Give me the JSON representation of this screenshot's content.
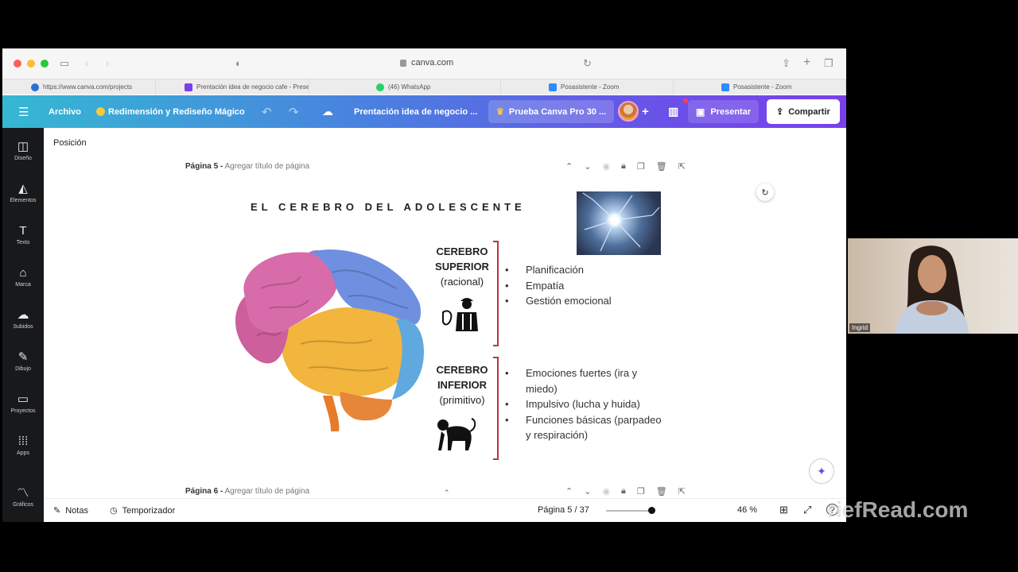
{
  "browser": {
    "address": "canva.com",
    "tabs": [
      {
        "label": "https://www.canva.com/projects",
        "icon": "canva-favicon",
        "color": "#2b6fd6"
      },
      {
        "label": "Prentación idea de negocio cafe - Presen...",
        "icon": "canva-favicon",
        "color": "#7a3fea"
      },
      {
        "label": "(46) WhatsApp",
        "icon": "whatsapp-favicon",
        "color": "#25d366"
      },
      {
        "label": "Posasistente - Zoom",
        "icon": "zoom-favicon",
        "color": "#2d8cff"
      },
      {
        "label": "Posasistente - Zoom",
        "icon": "zoom-favicon",
        "color": "#2d8cff"
      }
    ]
  },
  "header": {
    "archivo": "Archivo",
    "magic": "Redimensión y Rediseño Mágico",
    "doc_title": "Prentación idea de negocio ...",
    "pro": "Prueba Canva Pro 30 ...",
    "presentar": "Presentar",
    "compartir": "Compartir",
    "accent": "#7a3fea"
  },
  "rail": [
    {
      "label": "Diseño",
      "icon": "layout-icon"
    },
    {
      "label": "Elementos",
      "icon": "shapes-icon"
    },
    {
      "label": "Texto",
      "icon": "text-icon"
    },
    {
      "label": "Marca",
      "icon": "brand-icon"
    },
    {
      "label": "Subidos",
      "icon": "upload-icon"
    },
    {
      "label": "Dibujo",
      "icon": "draw-icon"
    },
    {
      "label": "Proyectos",
      "icon": "folder-icon"
    },
    {
      "label": "Apps",
      "icon": "apps-icon"
    },
    {
      "label": "Gráficos",
      "icon": "charts-icon"
    }
  ],
  "canvas": {
    "posicion": "Posición",
    "page5_num": "Página 5 -",
    "page5_sub": "Agregar título de página",
    "page6_num": "Página 6 -",
    "page6_sub": "Agregar título de página"
  },
  "slide": {
    "title": "EL CEREBRO DEL ADOLESCENTE",
    "superior": {
      "l1": "CEREBRO",
      "l2": "SUPERIOR",
      "l3": "(racional)"
    },
    "inferior": {
      "l1": "CEREBRO",
      "l2": "INFERIOR",
      "l3": "(primitivo)"
    },
    "superior_items": [
      "Planificación",
      "Empatía",
      "Gestión emocional"
    ],
    "inferior_items": [
      "Emociones fuertes (ira y miedo)",
      "Impulsivo (lucha y huida)",
      "Funciones básicas (parpadeo y respiración)"
    ]
  },
  "footer": {
    "notas": "Notas",
    "temporizador": "Temporizador",
    "pagina": "Página 5 / 37",
    "zoom": "46 %"
  },
  "video": {
    "name": "Ingrid"
  },
  "watermark": "riefRead.com"
}
